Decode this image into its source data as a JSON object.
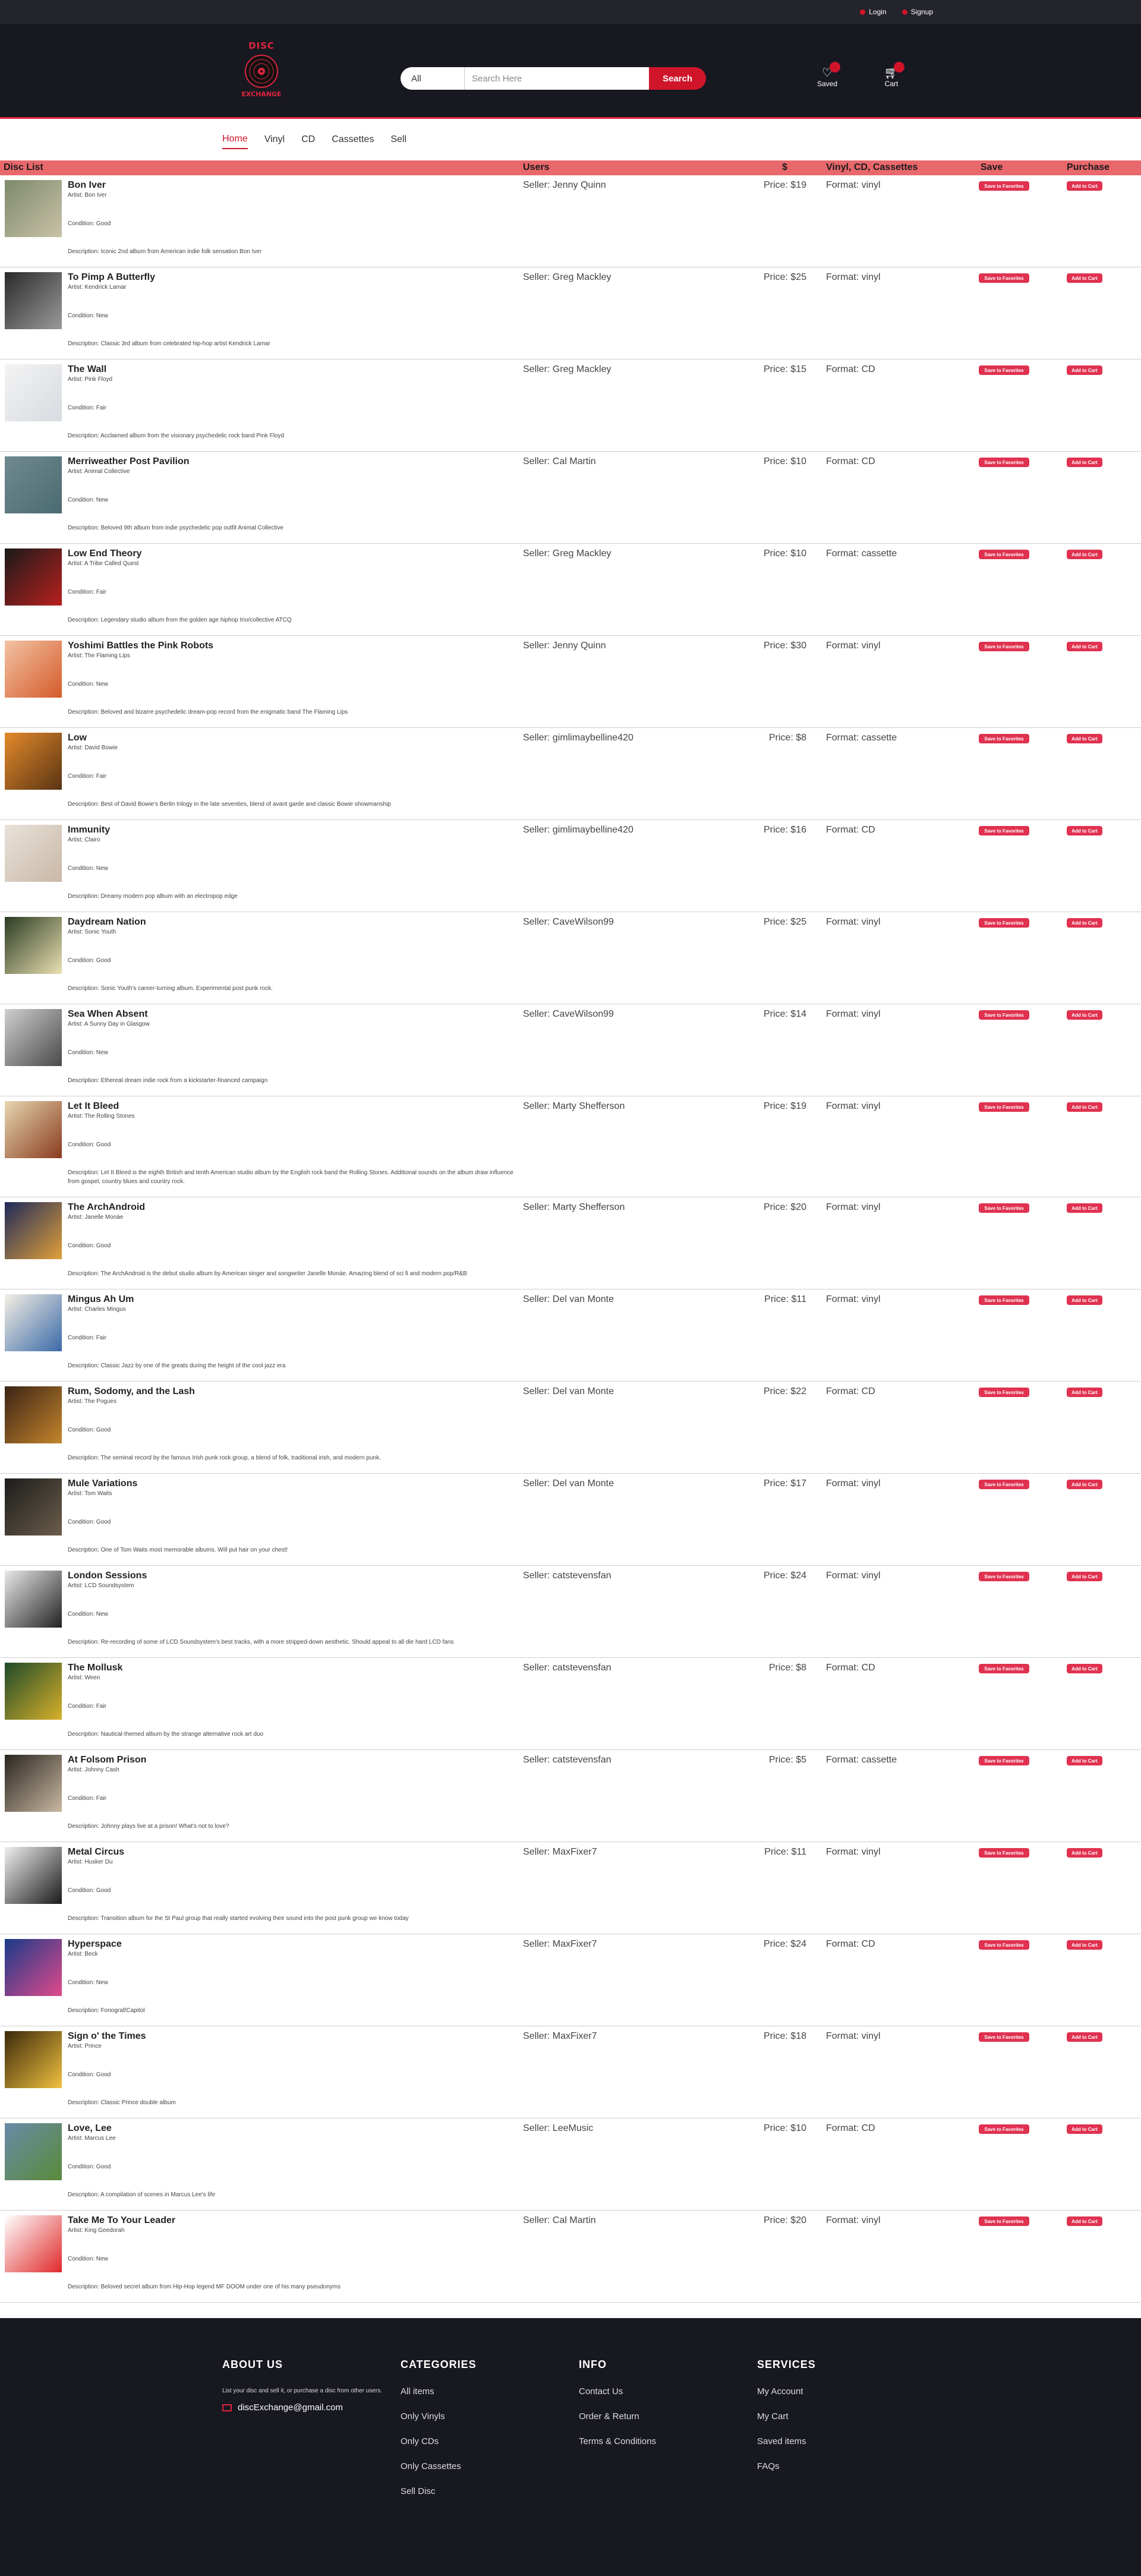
{
  "topbar": {
    "login": "Login",
    "signup": "Signup"
  },
  "logo": {
    "top": "DISC",
    "bottom": "EXCHANGE"
  },
  "search": {
    "category": "All",
    "placeholder": "Search Here",
    "button": "Search"
  },
  "header_icons": {
    "saved": "Saved",
    "cart": "Cart"
  },
  "nav": [
    "Home",
    "Vinyl",
    "CD",
    "Cassettes",
    "Sell"
  ],
  "table_header": {
    "disc_list": "Disc List",
    "users": "Users",
    "price": "$",
    "format": "Vinyl, CD, Cassettes",
    "save": "Save",
    "purchase": "Purchase"
  },
  "buttons": {
    "favorite": "Save to Favorites",
    "cart": "Add to Cart"
  },
  "accent_color": "#d0142a",
  "discs": [
    {
      "title": "Bon Iver",
      "artist": "Artist: Bon Iver",
      "condition": "Condition: Good",
      "description": "Description: Iconic 2nd album from American indie folk sensation Bon Iver",
      "seller": "Seller: Jenny Quinn",
      "price": "Price: $19",
      "format": "Format: vinyl"
    },
    {
      "title": "To Pimp A Butterfly",
      "artist": "Artist: Kendrick Lamar",
      "condition": "Condition: New",
      "description": "Description: Classic 3rd album from celebrated hip-hop artist Kendrick Lamar",
      "seller": "Seller: Greg Mackley",
      "price": "Price: $25",
      "format": "Format: vinyl"
    },
    {
      "title": "The Wall",
      "artist": "Artist: Pink Floyd",
      "condition": "Condition: Fair",
      "description": "Description: Acclaimed album from the visionary psychedelic rock band Pink Floyd",
      "seller": "Seller: Greg Mackley",
      "price": "Price: $15",
      "format": "Format: CD"
    },
    {
      "title": "Merriweather Post Pavilion",
      "artist": "Artist: Animal Collective",
      "condition": "Condition: New",
      "description": "Description: Beloved 9th album from indie psychedelic pop outfit Animal Collective",
      "seller": "Seller: Cal Martin",
      "price": "Price: $10",
      "format": "Format: CD"
    },
    {
      "title": "Low End Theory",
      "artist": "Artist: A Tribe Called Quest",
      "condition": "Condition: Fair",
      "description": "Description: Legendary studio album from the golden age hiphop trio/collective ATCQ",
      "seller": "Seller: Greg Mackley",
      "price": "Price: $10",
      "format": "Format: cassette"
    },
    {
      "title": "Yoshimi Battles the Pink Robots",
      "artist": "Artist: The Flaming Lips",
      "condition": "Condition: New",
      "description": "Description: Beloved and bizarre psychedelic dream-pop record from the enigmatic band The Flaming Lips",
      "seller": "Seller: Jenny Quinn",
      "price": "Price: $30",
      "format": "Format: vinyl"
    },
    {
      "title": "Low",
      "artist": "Artist: David Bowie",
      "condition": "Condition: Fair",
      "description": "Description: Best of David Bowie's Berlin trilogy in the late seventies, blend of avant garde and classic Bowie showmanship",
      "seller": "Seller: gimlimaybelline420",
      "price": "Price: $8",
      "format": "Format: cassette"
    },
    {
      "title": "Immunity",
      "artist": "Artist: Clairo",
      "condition": "Condition: New",
      "description": "Description: Dreamy modern pop album with an electropop edge",
      "seller": "Seller: gimlimaybelline420",
      "price": "Price: $16",
      "format": "Format: CD"
    },
    {
      "title": "Daydream Nation",
      "artist": "Artist: Sonic Youth",
      "condition": "Condition: Good",
      "description": "Description: Sonic Youth's career-turning album. Experimental post punk rock.",
      "seller": "Seller: CaveWilson99",
      "price": "Price: $25",
      "format": "Format: vinyl"
    },
    {
      "title": "Sea When Absent",
      "artist": "Artist: A Sunny Day in Glasgow",
      "condition": "Condition: New",
      "description": "Description: Ethereal dream indie rock from a kickstarter-financed campaign",
      "seller": "Seller: CaveWilson99",
      "price": "Price: $14",
      "format": "Format: vinyl"
    },
    {
      "title": "Let It Bleed",
      "artist": "Artist: The Rolling Stones",
      "condition": "Condition: Good",
      "description": "Description: Let It Bleed is the eighth British and tenth American studio album by the English rock band the Rolling Stones. Additional sounds on the album draw influence from gospel, country blues and country rock.",
      "seller": "Seller: Marty Shefferson",
      "price": "Price: $19",
      "format": "Format: vinyl"
    },
    {
      "title": "The ArchAndroid",
      "artist": "Artist: Janelle Monáe",
      "condition": "Condition: Good",
      "description": "Description: The ArchAndroid is the debut studio album by American singer and songwriter Janelle Monáe. Amazing blend of sci fi and modern pop/R&B",
      "seller": "Seller: Marty Shefferson",
      "price": "Price: $20",
      "format": "Format: vinyl"
    },
    {
      "title": "Mingus Ah Um",
      "artist": "Artist: Charles Mingus",
      "condition": "Condition: Fair",
      "description": "Description: Classic Jazz by one of the greats during the height of the cool jazz era",
      "seller": "Seller: Del van Monte",
      "price": "Price: $11",
      "format": "Format: vinyl"
    },
    {
      "title": "Rum, Sodomy, and the Lash",
      "artist": "Artist: The Pogues",
      "condition": "Condition: Good",
      "description": "Description: The seminal record by the famous Irish punk rock group, a blend of folk, traditional irish, and modern punk.",
      "seller": "Seller: Del van Monte",
      "price": "Price: $22",
      "format": "Format: CD"
    },
    {
      "title": "Mule Variations",
      "artist": "Artist: Tom Waits",
      "condition": "Condition: Good",
      "description": "Description: One of Tom Waits most memorable albums. Will put hair on your chest!",
      "seller": "Seller: Del van Monte",
      "price": "Price: $17",
      "format": "Format: vinyl"
    },
    {
      "title": "London Sessions",
      "artist": "Artist: LCD Soundsystem",
      "condition": "Condition: New",
      "description": "Description: Re-recording of some of LCD Soundsystem's best tracks, with a more stripped-down aesthetic. Should appeal to all die hard LCD fans",
      "seller": "Seller: catstevensfan",
      "price": "Price: $24",
      "format": "Format: vinyl"
    },
    {
      "title": "The Mollusk",
      "artist": "Artist: Ween",
      "condition": "Condition: Fair",
      "description": "Description: Nautical-themed album by the strange alternative rock art duo",
      "seller": "Seller: catstevensfan",
      "price": "Price: $8",
      "format": "Format: CD"
    },
    {
      "title": "At Folsom Prison",
      "artist": "Artist: Johnny Cash",
      "condition": "Condition: Fair",
      "description": "Description: Johnny plays live at a prison! What's not to love?",
      "seller": "Seller: catstevensfan",
      "price": "Price: $5",
      "format": "Format: cassette"
    },
    {
      "title": "Metal Circus",
      "artist": "Artist: Husker Du",
      "condition": "Condition: Good",
      "description": "Description: Transition album for the St Paul group that really started evolving their sound into the post punk group we know today",
      "seller": "Seller: MaxFixer7",
      "price": "Price: $11",
      "format": "Format: vinyl"
    },
    {
      "title": "Hyperspace",
      "artist": "Artist: Beck",
      "condition": "Condition: New",
      "description": "Description: Fonograf/Capitol",
      "seller": "Seller: MaxFixer7",
      "price": "Price: $24",
      "format": "Format: CD"
    },
    {
      "title": "Sign o' the Times",
      "artist": "Artist: Prince",
      "condition": "Condition: Good",
      "description": "Description: Classic Prince double album",
      "seller": "Seller: MaxFixer7",
      "price": "Price: $18",
      "format": "Format: vinyl"
    },
    {
      "title": "Love, Lee",
      "artist": "Artist: Marcus Lee",
      "condition": "Condition: Good",
      "description": "Description: A compilation of scenes in Marcus Lee's life",
      "seller": "Seller: LeeMusic",
      "price": "Price: $10",
      "format": "Format: CD"
    },
    {
      "title": "Take Me To Your Leader",
      "artist": "Artist: King Geedorah",
      "condition": "Condition: New",
      "description": "Description: Beloved secret album from Hip-Hop legend MF DOOM under one of his many pseudonyms",
      "seller": "Seller: Cal Martin",
      "price": "Price: $20",
      "format": "Format: vinyl"
    }
  ],
  "footer": {
    "about": {
      "heading": "ABOUT US",
      "text": "List your disc and sell it, or purchase a disc from other users.",
      "email": "discExchange@gmail.com"
    },
    "categories": {
      "heading": "CATEGORIES",
      "links": [
        "All items",
        "Only Vinyls",
        "Only CDs",
        "Only Cassettes",
        "Sell Disc"
      ]
    },
    "info": {
      "heading": "INFO",
      "links": [
        "Contact Us",
        "Order & Return",
        "Terms & Conditions"
      ]
    },
    "services": {
      "heading": "SERVICES",
      "links": [
        "My Account",
        "My Cart",
        "Saved items",
        "FAQs"
      ]
    }
  }
}
